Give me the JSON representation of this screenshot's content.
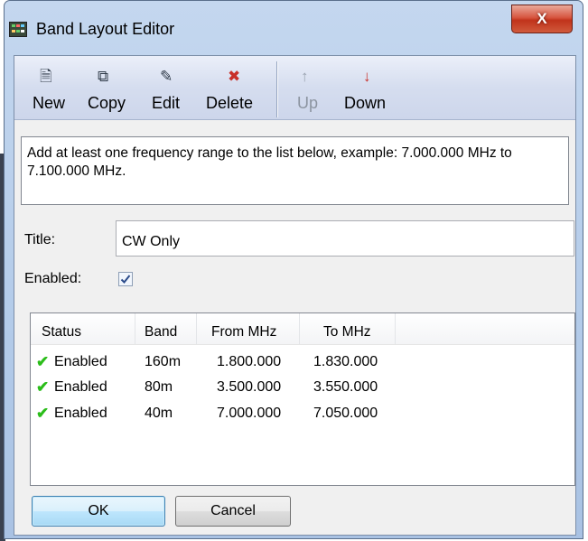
{
  "window": {
    "title": "Band Layout Editor",
    "close_glyph": "X"
  },
  "toolbar": {
    "buttons": [
      {
        "label": "New",
        "icon": "new-document-icon",
        "glyph": "🗎",
        "color": "#2f3a48",
        "enabled": true
      },
      {
        "label": "Copy",
        "icon": "copy-icon",
        "glyph": "⧉",
        "color": "#2f3a48",
        "enabled": true
      },
      {
        "label": "Edit",
        "icon": "edit-icon",
        "glyph": "✎",
        "color": "#2f3a48",
        "enabled": true
      },
      {
        "label": "Delete",
        "icon": "delete-icon",
        "glyph": "✖",
        "color": "#c8302a",
        "enabled": true
      },
      {
        "label": "Up",
        "icon": "arrow-up-icon",
        "glyph": "↑",
        "color": "#9aa3b0",
        "enabled": false
      },
      {
        "label": "Down",
        "icon": "arrow-down-icon",
        "glyph": "↓",
        "color": "#c8302a",
        "enabled": true
      }
    ]
  },
  "hint": {
    "text": "Add at least one frequency range to the list below, example: 7.000.000 MHz to 7.100.000 MHz."
  },
  "form": {
    "title_label": "Title:",
    "title_value": "CW Only",
    "enabled_label": "Enabled:",
    "enabled_checked": true
  },
  "list": {
    "columns": [
      "Status",
      "Band",
      "From MHz",
      "To MHz"
    ],
    "rows": [
      {
        "status": "Enabled",
        "band": "160m",
        "from": "1.800.000",
        "to": "1.830.000"
      },
      {
        "status": "Enabled",
        "band": "80m",
        "from": "3.500.000",
        "to": "3.550.000"
      },
      {
        "status": "Enabled",
        "band": "40m",
        "from": "7.000.000",
        "to": "7.050.000"
      }
    ],
    "check_glyph": "✔"
  },
  "buttons": {
    "ok": "OK",
    "cancel": "Cancel"
  },
  "colors": {
    "check_green": "#2bbd1a",
    "close_red": "#c1331b",
    "toolbar_blue": "#d5ddef"
  }
}
